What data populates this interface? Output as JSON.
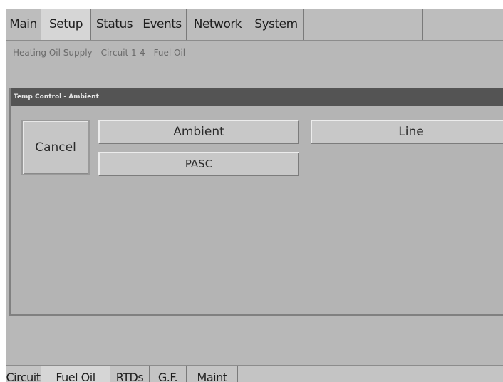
{
  "top_tabs": [
    {
      "label": "Main"
    },
    {
      "label": "Setup"
    },
    {
      "label": "Status"
    },
    {
      "label": "Events"
    },
    {
      "label": "Network"
    },
    {
      "label": "System"
    }
  ],
  "active_top_tab": "Setup",
  "group": {
    "caption": "Heating Oil Supply - Circuit 1-4 - Fuel Oil"
  },
  "dialog": {
    "title": "Temp Control - Ambient",
    "buttons": {
      "cancel": "Cancel",
      "ambient": "Ambient",
      "line": "Line",
      "pasc": "PASC"
    }
  },
  "bottom_tabs": [
    {
      "label": "Circuit"
    },
    {
      "label": "Fuel Oil"
    },
    {
      "label": "RTDs"
    },
    {
      "label": "G.F."
    },
    {
      "label": "Maint"
    }
  ],
  "active_bottom_tab": "Fuel Oil"
}
